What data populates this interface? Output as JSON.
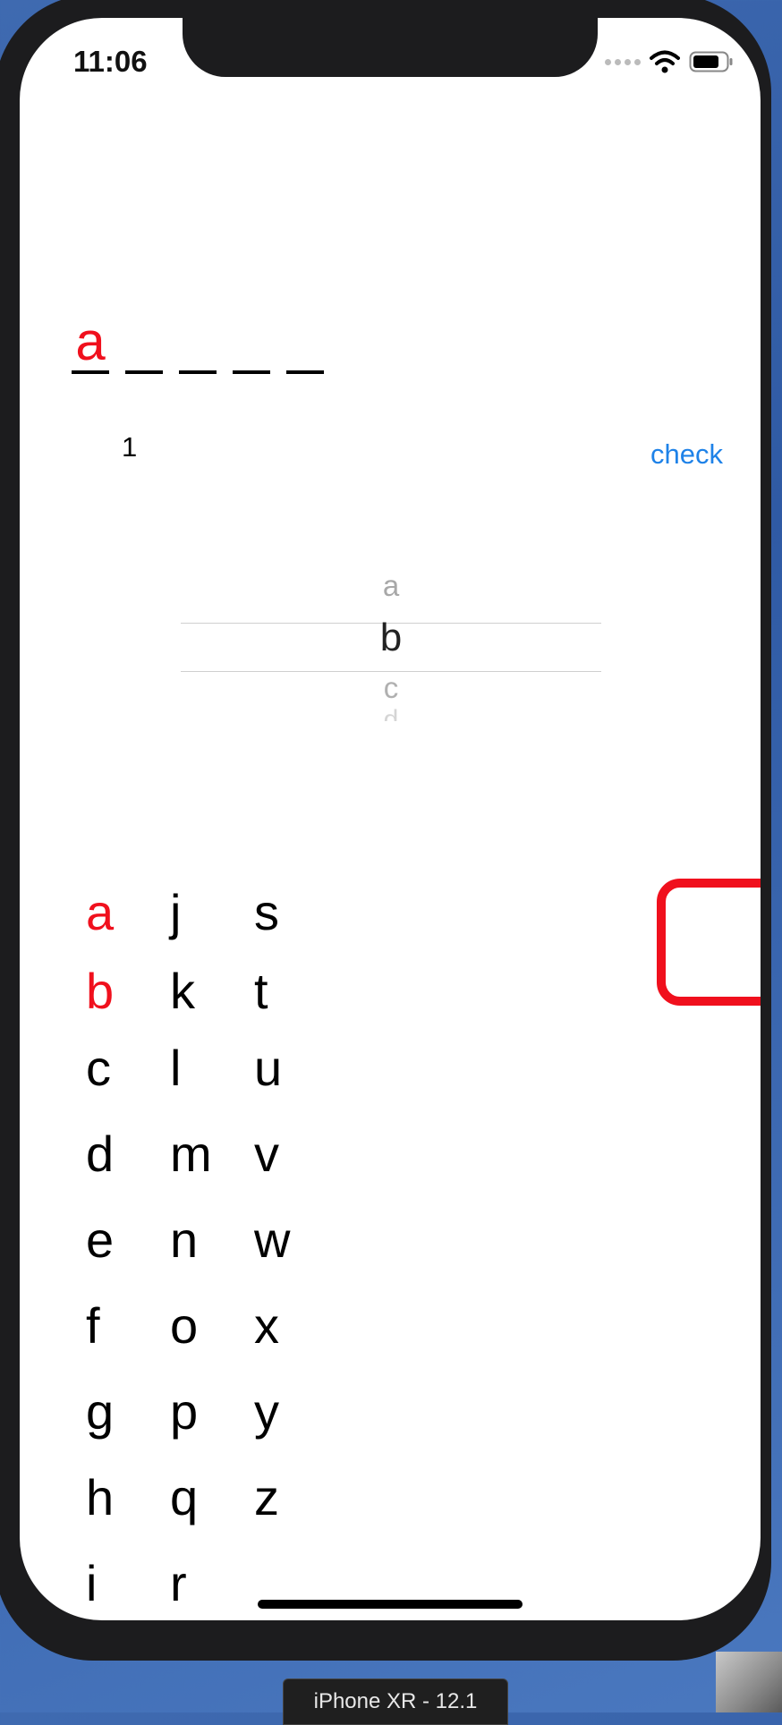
{
  "status_bar": {
    "time": "11:06",
    "signal_icon": "signal-dots-icon",
    "wifi_icon": "wifi-icon",
    "battery_icon": "battery-icon"
  },
  "word_slots": [
    "a",
    "",
    "",
    "",
    ""
  ],
  "counter": "1",
  "check_label": "check",
  "picker": {
    "above": "a",
    "selected": "b",
    "below": "c",
    "faded": "d"
  },
  "alphabet": {
    "col1": [
      "a",
      "b",
      "c",
      "d",
      "e",
      "f",
      "g",
      "h",
      "i"
    ],
    "col2": [
      "j",
      "k",
      "l",
      "m",
      "n",
      "o",
      "p",
      "q",
      "r"
    ],
    "col3": [
      "s",
      "t",
      "u",
      "v",
      "w",
      "x",
      "y",
      "z"
    ],
    "highlighted": [
      "a",
      "b"
    ]
  },
  "colors": {
    "accent_red": "#f0101d",
    "link_blue": "#1e82e8"
  },
  "simulator_label": "iPhone XR - 12.1"
}
